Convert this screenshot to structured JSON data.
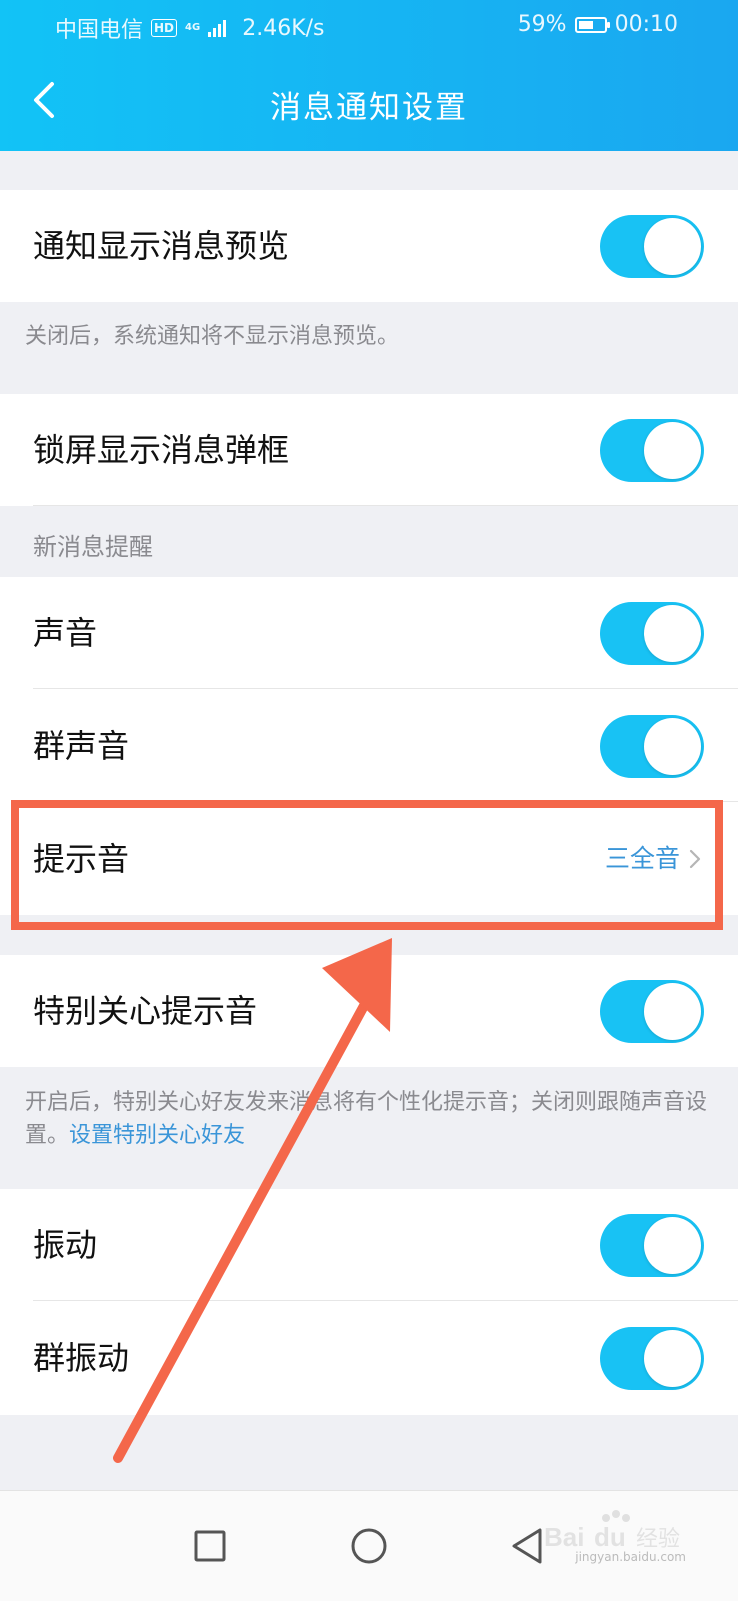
{
  "status_bar": {
    "carrier": "中国电信",
    "hd": "HD",
    "network_type": "4G",
    "speed": "2.46K/s",
    "battery_percent": "59%",
    "battery_level": 0.59,
    "time": "00:10"
  },
  "header": {
    "title": "消息通知设置",
    "back_icon": "chevron-left-icon"
  },
  "settings": {
    "preview": {
      "label": "通知显示消息预览",
      "enabled": true
    },
    "preview_note": "关闭后，系统通知将不显示消息预览。",
    "lockscreen": {
      "label": "锁屏显示消息弹框",
      "enabled": true
    },
    "section_title": "新消息提醒",
    "sound": {
      "label": "声音",
      "enabled": true
    },
    "group_sound": {
      "label": "群声音",
      "enabled": true
    },
    "tone": {
      "label": "提示音",
      "value": "三全音"
    },
    "special_tone": {
      "label": "特别关心提示音",
      "enabled": true
    },
    "special_note": "开启后，特别关心好友发来消息将有个性化提示音；关闭则跟随声音设置。",
    "special_link": "设置特别关心好友",
    "vibrate": {
      "label": "振动",
      "enabled": true
    },
    "group_vibrate": {
      "label": "群振动",
      "enabled": true
    }
  },
  "nav_bar": {
    "icons": [
      "square-icon",
      "circle-icon",
      "triangle-back-icon"
    ]
  },
  "watermark": {
    "logo_text": "Bai du 经验",
    "url": "jingyan.baidu.com"
  },
  "colors": {
    "header_gradient_start": "#12c3f6",
    "header_gradient_end": "#1aa7f0",
    "toggle_on": "#18c2f4",
    "link": "#3a95d8",
    "annotation": "#f4674a"
  }
}
